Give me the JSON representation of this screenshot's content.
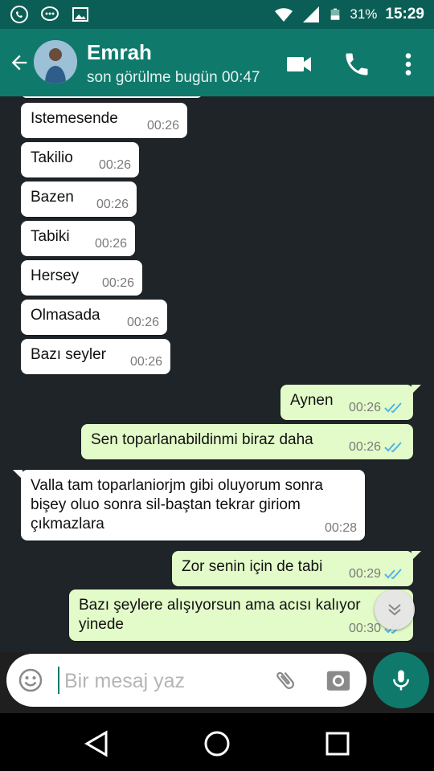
{
  "status_bar": {
    "battery": "31%",
    "time": "15:29",
    "icons": [
      "whatsapp-icon",
      "chat-icon",
      "image-icon",
      "wifi-icon",
      "signal-icon",
      "battery-icon"
    ]
  },
  "header": {
    "contact_name": "Emrah",
    "last_seen": "son görülme bugün 00:47",
    "icons": [
      "back-arrow-icon",
      "video-call-icon",
      "phone-icon",
      "more-vert-icon"
    ]
  },
  "messages": [
    {
      "dir": "in",
      "text": "Istemesende",
      "time": "00:26"
    },
    {
      "dir": "in",
      "text": "Takilio",
      "time": "00:26"
    },
    {
      "dir": "in",
      "text": "Bazen",
      "time": "00:26"
    },
    {
      "dir": "in",
      "text": "Tabiki",
      "time": "00:26"
    },
    {
      "dir": "in",
      "text": "Hersey",
      "time": "00:26"
    },
    {
      "dir": "in",
      "text": "Olmasada",
      "time": "00:26"
    },
    {
      "dir": "in",
      "text": "Bazı seyler",
      "time": "00:26"
    },
    {
      "dir": "out",
      "text": "Aynen",
      "time": "00:26",
      "ticks": "read"
    },
    {
      "dir": "out",
      "text": "Sen toparlanabildinmi biraz daha",
      "time": "00:26",
      "ticks": "read"
    },
    {
      "dir": "in",
      "text": "Valla tam toparlaniorjm gibi oluyorum sonra bişey oluo sonra sil-baştan tekrar giriom çıkmazlara",
      "time": "00:28"
    },
    {
      "dir": "out",
      "text": "Zor senin için de tabi",
      "time": "00:29",
      "ticks": "read"
    },
    {
      "dir": "out",
      "text": "Bazı şeylere alışıyorsun ama acısı kalıyor yinede",
      "time": "00:30",
      "ticks": "read"
    }
  ],
  "composer": {
    "placeholder": "Bir mesaj yaz",
    "icons": [
      "emoji-icon",
      "attach-icon",
      "camera-icon",
      "mic-icon"
    ]
  },
  "colors": {
    "header": "#0f7a6c",
    "status_bar": "#0b5e55",
    "incoming_bubble": "#ffffff",
    "outgoing_bubble": "#e2fbc8",
    "read_ticks": "#4fb3e8",
    "chat_background": "#1f2428"
  }
}
